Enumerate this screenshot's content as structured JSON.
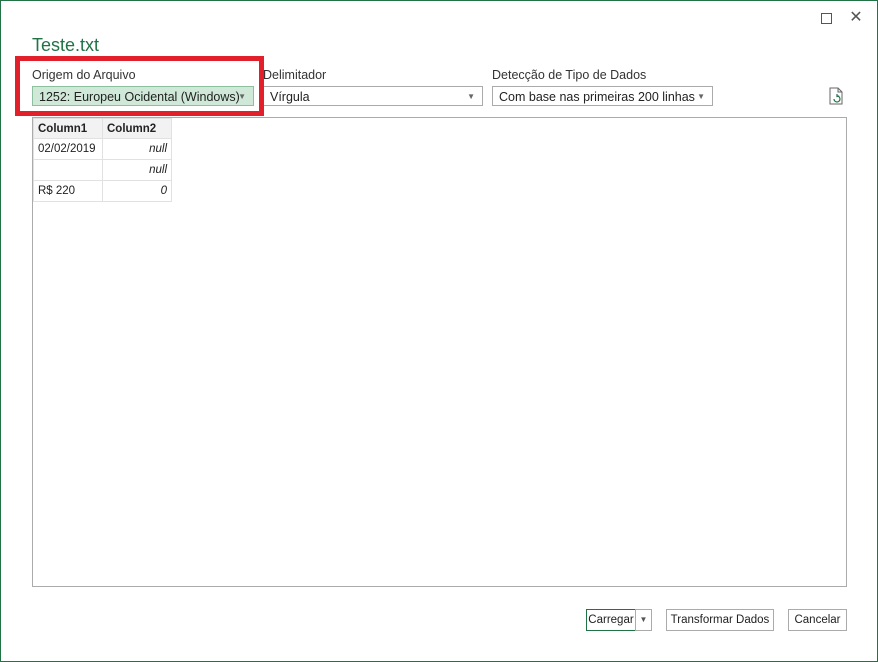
{
  "window": {
    "maximize_label": "",
    "close_glyph": "✕"
  },
  "title": "Teste.txt",
  "file_origin": {
    "label": "Origem do Arquivo",
    "value": "1252: Europeu Ocidental (Windows)"
  },
  "delimiter": {
    "label": "Delimitador",
    "value": "Vírgula"
  },
  "detection": {
    "label": "Detecção de Tipo de Dados",
    "value": "Com base nas primeiras 200 linhas"
  },
  "preview_table": {
    "headers": [
      "Column1",
      "Column2"
    ],
    "rows": [
      [
        "02/02/2019",
        "null"
      ],
      [
        "",
        "null"
      ],
      [
        "R$ 220",
        "0"
      ]
    ]
  },
  "buttons": {
    "load": "Carregar",
    "transform": "Transformar Dados",
    "cancel": "Cancelar"
  },
  "colors": {
    "accent": "#217346",
    "highlight": "#e2202c",
    "selected_bg": "#cfe8d8"
  }
}
